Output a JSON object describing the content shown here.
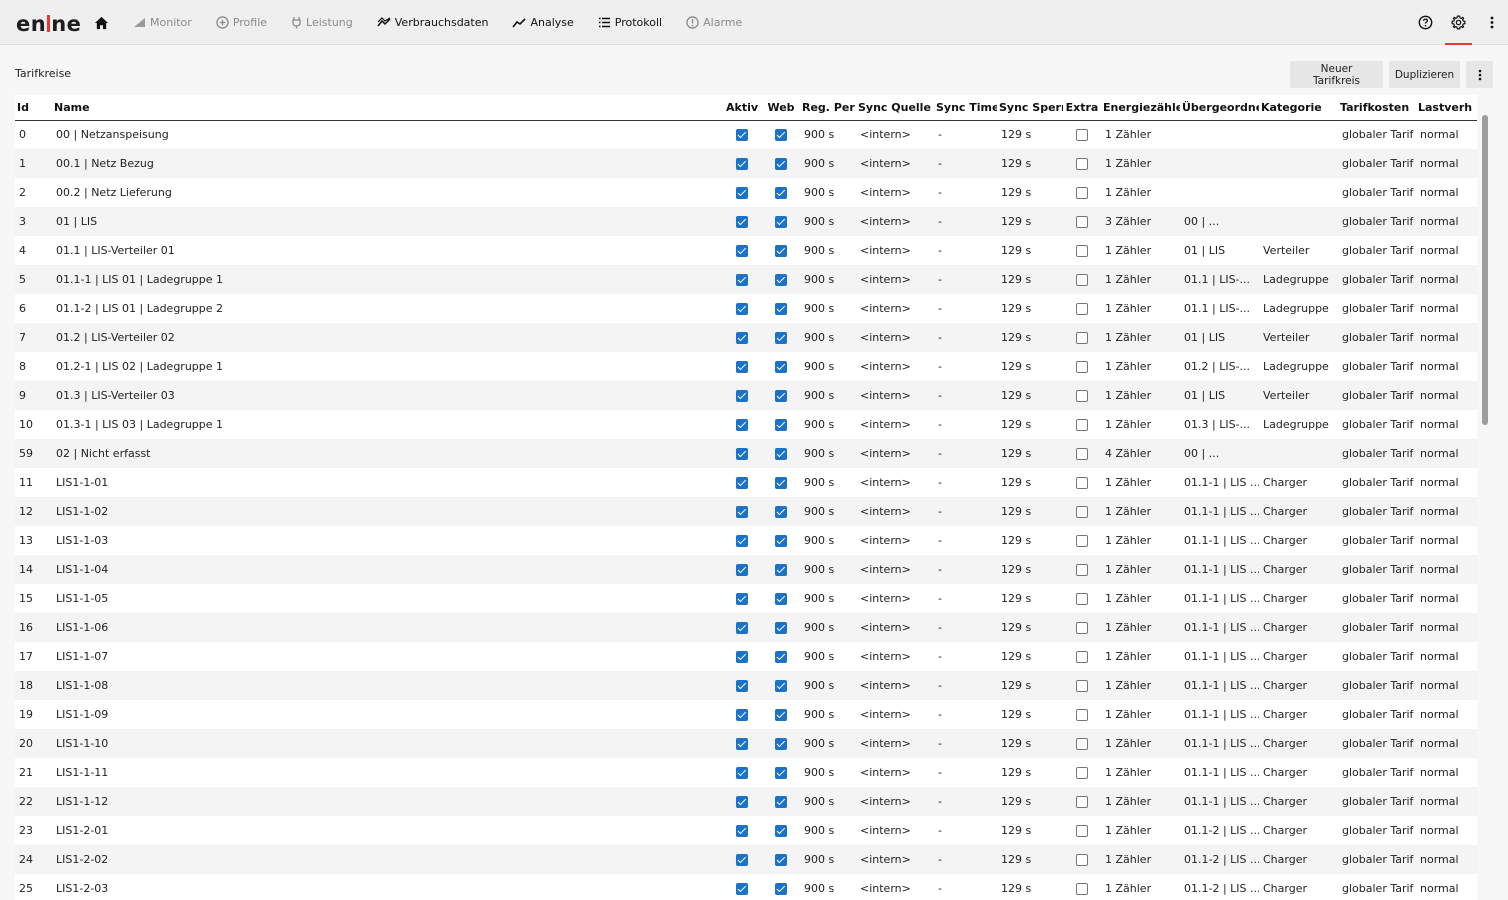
{
  "app": {
    "logo_text_left": "en",
    "logo_text_right": "ne"
  },
  "nav": [
    {
      "label": "Monitor",
      "icon": "signal-icon",
      "disabled": true
    },
    {
      "label": "Profile",
      "icon": "plus-circle-icon",
      "disabled": true
    },
    {
      "label": "Leistung",
      "icon": "plug-icon",
      "disabled": true
    },
    {
      "label": "Verbrauchsdaten",
      "icon": "trend-icon",
      "disabled": false
    },
    {
      "label": "Analyse",
      "icon": "chart-line-icon",
      "disabled": false
    },
    {
      "label": "Protokoll",
      "icon": "list-icon",
      "disabled": false
    },
    {
      "label": "Alarme",
      "icon": "alert-icon",
      "disabled": true
    }
  ],
  "page": {
    "title": "Tarifkreise",
    "new_button": "Neuer Tarifkreis",
    "duplicate_button": "Duplizieren"
  },
  "table": {
    "columns": [
      "Id",
      "Name",
      "Aktiv",
      "Web",
      "Reg. Per",
      "Sync Quelle",
      "Sync Time",
      "Sync Sperr",
      "Extra",
      "Energiezähle",
      "Übergeordne",
      "Kategorie",
      "Tarifkosten",
      "Lastverh"
    ],
    "rows": [
      {
        "id": "0",
        "name": "00 | Netzanspeisung",
        "aktiv": true,
        "web": true,
        "reg": "900 s",
        "quelle": "<intern>",
        "time": "-",
        "sperr": "129 s",
        "extra": false,
        "zaehler": "1 Zähler",
        "parent": "",
        "kategorie": "",
        "tarif": "globaler Tarif",
        "last": "normal"
      },
      {
        "id": "1",
        "name": "00.1 | Netz Bezug",
        "aktiv": true,
        "web": true,
        "reg": "900 s",
        "quelle": "<intern>",
        "time": "-",
        "sperr": "129 s",
        "extra": false,
        "zaehler": "1 Zähler",
        "parent": "",
        "kategorie": "",
        "tarif": "globaler Tarif",
        "last": "normal"
      },
      {
        "id": "2",
        "name": "00.2 | Netz Lieferung",
        "aktiv": true,
        "web": true,
        "reg": "900 s",
        "quelle": "<intern>",
        "time": "-",
        "sperr": "129 s",
        "extra": false,
        "zaehler": "1 Zähler",
        "parent": "",
        "kategorie": "",
        "tarif": "globaler Tarif",
        "last": "normal"
      },
      {
        "id": "3",
        "name": "01 | LIS",
        "aktiv": true,
        "web": true,
        "reg": "900 s",
        "quelle": "<intern>",
        "time": "-",
        "sperr": "129 s",
        "extra": false,
        "zaehler": "3 Zähler",
        "parent": "00 | ...",
        "kategorie": "",
        "tarif": "globaler Tarif",
        "last": "normal"
      },
      {
        "id": "4",
        "name": "01.1 | LIS-Verteiler 01",
        "aktiv": true,
        "web": true,
        "reg": "900 s",
        "quelle": "<intern>",
        "time": "-",
        "sperr": "129 s",
        "extra": false,
        "zaehler": "1 Zähler",
        "parent": "01 | LIS",
        "kategorie": "Verteiler",
        "tarif": "globaler Tarif",
        "last": "normal"
      },
      {
        "id": "5",
        "name": "01.1-1 | LIS 01 | Ladegruppe 1",
        "aktiv": true,
        "web": true,
        "reg": "900 s",
        "quelle": "<intern>",
        "time": "-",
        "sperr": "129 s",
        "extra": false,
        "zaehler": "1 Zähler",
        "parent": "01.1 | LIS-...",
        "kategorie": "Ladegruppe",
        "tarif": "globaler Tarif",
        "last": "normal"
      },
      {
        "id": "6",
        "name": "01.1-2 | LIS 01 | Ladegruppe 2",
        "aktiv": true,
        "web": true,
        "reg": "900 s",
        "quelle": "<intern>",
        "time": "-",
        "sperr": "129 s",
        "extra": false,
        "zaehler": "1 Zähler",
        "parent": "01.1 | LIS-...",
        "kategorie": "Ladegruppe",
        "tarif": "globaler Tarif",
        "last": "normal"
      },
      {
        "id": "7",
        "name": "01.2 | LIS-Verteiler 02",
        "aktiv": true,
        "web": true,
        "reg": "900 s",
        "quelle": "<intern>",
        "time": "-",
        "sperr": "129 s",
        "extra": false,
        "zaehler": "1 Zähler",
        "parent": "01 | LIS",
        "kategorie": "Verteiler",
        "tarif": "globaler Tarif",
        "last": "normal"
      },
      {
        "id": "8",
        "name": "01.2-1 | LIS 02 | Ladegruppe 1",
        "aktiv": true,
        "web": true,
        "reg": "900 s",
        "quelle": "<intern>",
        "time": "-",
        "sperr": "129 s",
        "extra": false,
        "zaehler": "1 Zähler",
        "parent": "01.2 | LIS-...",
        "kategorie": "Ladegruppe",
        "tarif": "globaler Tarif",
        "last": "normal"
      },
      {
        "id": "9",
        "name": "01.3 | LIS-Verteiler 03",
        "aktiv": true,
        "web": true,
        "reg": "900 s",
        "quelle": "<intern>",
        "time": "-",
        "sperr": "129 s",
        "extra": false,
        "zaehler": "1 Zähler",
        "parent": "01 | LIS",
        "kategorie": "Verteiler",
        "tarif": "globaler Tarif",
        "last": "normal"
      },
      {
        "id": "10",
        "name": "01.3-1 | LIS 03 | Ladegruppe 1",
        "aktiv": true,
        "web": true,
        "reg": "900 s",
        "quelle": "<intern>",
        "time": "-",
        "sperr": "129 s",
        "extra": false,
        "zaehler": "1 Zähler",
        "parent": "01.3 | LIS-...",
        "kategorie": "Ladegruppe",
        "tarif": "globaler Tarif",
        "last": "normal"
      },
      {
        "id": "59",
        "name": "02 | Nicht erfasst",
        "aktiv": true,
        "web": true,
        "reg": "900 s",
        "quelle": "<intern>",
        "time": "-",
        "sperr": "129 s",
        "extra": false,
        "zaehler": "4 Zähler",
        "parent": "00 | ...",
        "kategorie": "",
        "tarif": "globaler Tarif",
        "last": "normal"
      },
      {
        "id": "11",
        "name": "LIS1-1-01",
        "aktiv": true,
        "web": true,
        "reg": "900 s",
        "quelle": "<intern>",
        "time": "-",
        "sperr": "129 s",
        "extra": false,
        "zaehler": "1 Zähler",
        "parent": "01.1-1 | LIS ...",
        "kategorie": "Charger",
        "tarif": "globaler Tarif",
        "last": "normal"
      },
      {
        "id": "12",
        "name": "LIS1-1-02",
        "aktiv": true,
        "web": true,
        "reg": "900 s",
        "quelle": "<intern>",
        "time": "-",
        "sperr": "129 s",
        "extra": false,
        "zaehler": "1 Zähler",
        "parent": "01.1-1 | LIS ...",
        "kategorie": "Charger",
        "tarif": "globaler Tarif",
        "last": "normal"
      },
      {
        "id": "13",
        "name": "LIS1-1-03",
        "aktiv": true,
        "web": true,
        "reg": "900 s",
        "quelle": "<intern>",
        "time": "-",
        "sperr": "129 s",
        "extra": false,
        "zaehler": "1 Zähler",
        "parent": "01.1-1 | LIS ...",
        "kategorie": "Charger",
        "tarif": "globaler Tarif",
        "last": "normal"
      },
      {
        "id": "14",
        "name": "LIS1-1-04",
        "aktiv": true,
        "web": true,
        "reg": "900 s",
        "quelle": "<intern>",
        "time": "-",
        "sperr": "129 s",
        "extra": false,
        "zaehler": "1 Zähler",
        "parent": "01.1-1 | LIS ...",
        "kategorie": "Charger",
        "tarif": "globaler Tarif",
        "last": "normal"
      },
      {
        "id": "15",
        "name": "LIS1-1-05",
        "aktiv": true,
        "web": true,
        "reg": "900 s",
        "quelle": "<intern>",
        "time": "-",
        "sperr": "129 s",
        "extra": false,
        "zaehler": "1 Zähler",
        "parent": "01.1-1 | LIS ...",
        "kategorie": "Charger",
        "tarif": "globaler Tarif",
        "last": "normal"
      },
      {
        "id": "16",
        "name": "LIS1-1-06",
        "aktiv": true,
        "web": true,
        "reg": "900 s",
        "quelle": "<intern>",
        "time": "-",
        "sperr": "129 s",
        "extra": false,
        "zaehler": "1 Zähler",
        "parent": "01.1-1 | LIS ...",
        "kategorie": "Charger",
        "tarif": "globaler Tarif",
        "last": "normal"
      },
      {
        "id": "17",
        "name": "LIS1-1-07",
        "aktiv": true,
        "web": true,
        "reg": "900 s",
        "quelle": "<intern>",
        "time": "-",
        "sperr": "129 s",
        "extra": false,
        "zaehler": "1 Zähler",
        "parent": "01.1-1 | LIS ...",
        "kategorie": "Charger",
        "tarif": "globaler Tarif",
        "last": "normal"
      },
      {
        "id": "18",
        "name": "LIS1-1-08",
        "aktiv": true,
        "web": true,
        "reg": "900 s",
        "quelle": "<intern>",
        "time": "-",
        "sperr": "129 s",
        "extra": false,
        "zaehler": "1 Zähler",
        "parent": "01.1-1 | LIS ...",
        "kategorie": "Charger",
        "tarif": "globaler Tarif",
        "last": "normal"
      },
      {
        "id": "19",
        "name": "LIS1-1-09",
        "aktiv": true,
        "web": true,
        "reg": "900 s",
        "quelle": "<intern>",
        "time": "-",
        "sperr": "129 s",
        "extra": false,
        "zaehler": "1 Zähler",
        "parent": "01.1-1 | LIS ...",
        "kategorie": "Charger",
        "tarif": "globaler Tarif",
        "last": "normal"
      },
      {
        "id": "20",
        "name": "LIS1-1-10",
        "aktiv": true,
        "web": true,
        "reg": "900 s",
        "quelle": "<intern>",
        "time": "-",
        "sperr": "129 s",
        "extra": false,
        "zaehler": "1 Zähler",
        "parent": "01.1-1 | LIS ...",
        "kategorie": "Charger",
        "tarif": "globaler Tarif",
        "last": "normal"
      },
      {
        "id": "21",
        "name": "LIS1-1-11",
        "aktiv": true,
        "web": true,
        "reg": "900 s",
        "quelle": "<intern>",
        "time": "-",
        "sperr": "129 s",
        "extra": false,
        "zaehler": "1 Zähler",
        "parent": "01.1-1 | LIS ...",
        "kategorie": "Charger",
        "tarif": "globaler Tarif",
        "last": "normal"
      },
      {
        "id": "22",
        "name": "LIS1-1-12",
        "aktiv": true,
        "web": true,
        "reg": "900 s",
        "quelle": "<intern>",
        "time": "-",
        "sperr": "129 s",
        "extra": false,
        "zaehler": "1 Zähler",
        "parent": "01.1-1 | LIS ...",
        "kategorie": "Charger",
        "tarif": "globaler Tarif",
        "last": "normal"
      },
      {
        "id": "23",
        "name": "LIS1-2-01",
        "aktiv": true,
        "web": true,
        "reg": "900 s",
        "quelle": "<intern>",
        "time": "-",
        "sperr": "129 s",
        "extra": false,
        "zaehler": "1 Zähler",
        "parent": "01.1-2 | LIS ...",
        "kategorie": "Charger",
        "tarif": "globaler Tarif",
        "last": "normal"
      },
      {
        "id": "24",
        "name": "LIS1-2-02",
        "aktiv": true,
        "web": true,
        "reg": "900 s",
        "quelle": "<intern>",
        "time": "-",
        "sperr": "129 s",
        "extra": false,
        "zaehler": "1 Zähler",
        "parent": "01.1-2 | LIS ...",
        "kategorie": "Charger",
        "tarif": "globaler Tarif",
        "last": "normal"
      },
      {
        "id": "25",
        "name": "LIS1-2-03",
        "aktiv": true,
        "web": true,
        "reg": "900 s",
        "quelle": "<intern>",
        "time": "-",
        "sperr": "129 s",
        "extra": false,
        "zaehler": "1 Zähler",
        "parent": "01.1-2 | LIS ...",
        "kategorie": "Charger",
        "tarif": "globaler Tarif",
        "last": "normal"
      }
    ]
  },
  "colors": {
    "accent": "#e53935",
    "checkbox": "#1a73c8"
  }
}
